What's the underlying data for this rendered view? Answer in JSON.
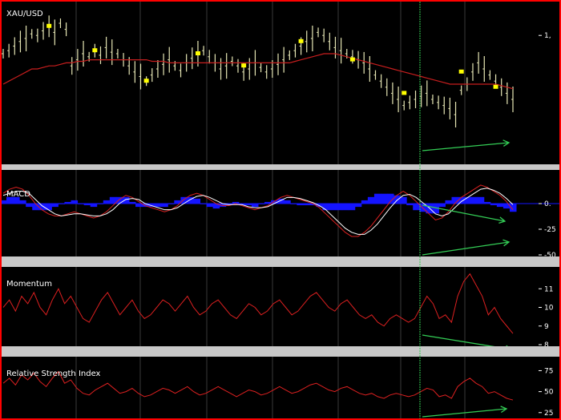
{
  "colors": {
    "background": "#000000",
    "frame": "#ff0000",
    "separator": "#c8c8c8",
    "grid": "#3a3a3a",
    "price_bar": "#e6e6b4",
    "marker": "#ffff00",
    "moving_average": "#c81e1e",
    "indicator_line": "#dc2020",
    "signal_line": "#ffffff",
    "histogram": "#1414ff",
    "annotation": "#33cc55"
  },
  "chart_data": [
    {
      "type": "bar",
      "title": "XAU/USD",
      "ylim": [
        0,
        100
      ],
      "y_ticks": [
        {
          "value": 82,
          "label": "1,"
        }
      ],
      "series": [
        {
          "values": [
            70,
            72,
            75,
            78,
            80,
            83,
            82,
            85,
            88,
            84,
            90,
            86,
            62,
            66,
            70,
            68,
            72,
            69,
            74,
            71,
            70,
            66,
            62,
            58,
            55,
            52,
            56,
            60,
            63,
            66,
            62,
            59,
            64,
            67,
            70,
            72,
            68,
            64,
            60,
            62,
            65,
            62,
            58,
            60,
            64,
            61,
            58,
            60,
            63,
            66,
            69,
            72,
            75,
            78,
            80,
            84,
            82,
            78,
            74,
            72,
            70,
            68,
            66,
            64,
            60,
            56,
            52,
            48,
            44,
            40,
            36,
            38,
            40,
            42,
            44,
            40,
            38,
            36,
            34,
            30,
            46,
            50,
            58,
            64,
            60,
            56,
            52,
            48,
            44,
            40
          ]
        },
        {
          "values": [
            50,
            52,
            54,
            56,
            58,
            60,
            60,
            61,
            62,
            62,
            63,
            64,
            64,
            65,
            65,
            66,
            66,
            66,
            66,
            66,
            66,
            66,
            66,
            66,
            66,
            66,
            65,
            65,
            65,
            64,
            64,
            64,
            64,
            64,
            64,
            64,
            64,
            64,
            64,
            64,
            64,
            64,
            64,
            64,
            64,
            64,
            64,
            64,
            64,
            64,
            64,
            65,
            66,
            67,
            68,
            69,
            70,
            70,
            70,
            69,
            68,
            67,
            66,
            65,
            64,
            63,
            62,
            61,
            60,
            59,
            58,
            57,
            56,
            55,
            54,
            53,
            52,
            51,
            50,
            50,
            50,
            50,
            50,
            50,
            50,
            50,
            50,
            49,
            48,
            47
          ]
        }
      ],
      "markers": [
        {
          "index": 8,
          "value": 88
        },
        {
          "index": 16,
          "value": 72
        },
        {
          "index": 25,
          "value": 52
        },
        {
          "index": 34,
          "value": 70
        },
        {
          "index": 42,
          "value": 62
        },
        {
          "index": 52,
          "value": 78
        },
        {
          "index": 61,
          "value": 66
        },
        {
          "index": 70,
          "value": 44
        },
        {
          "index": 80,
          "value": 58
        },
        {
          "index": 86,
          "value": 48
        }
      ]
    },
    {
      "type": "line",
      "title": "MACD",
      "ylim": [
        -50,
        25
      ],
      "y_ticks": [
        {
          "value": 0,
          "label": "0."
        },
        {
          "value": -25,
          "label": "-25"
        },
        {
          "value": -50,
          "label": "-50"
        }
      ],
      "series": [
        {
          "values": [
            10,
            14,
            16,
            14,
            8,
            0,
            -6,
            -10,
            -12,
            -12,
            -10,
            -8,
            -10,
            -12,
            -14,
            -12,
            -8,
            -2,
            4,
            8,
            6,
            2,
            -2,
            -4,
            -6,
            -8,
            -6,
            -2,
            4,
            8,
            10,
            8,
            4,
            0,
            -2,
            -2,
            0,
            -2,
            -4,
            -6,
            -4,
            -2,
            2,
            6,
            8,
            6,
            4,
            2,
            0,
            -4,
            -10,
            -16,
            -22,
            -28,
            -32,
            -32,
            -28,
            -22,
            -14,
            -6,
            2,
            8,
            12,
            8,
            2,
            -4,
            -10,
            -16,
            -14,
            -8,
            0,
            6,
            10,
            14,
            18,
            16,
            12,
            8,
            2,
            -6
          ]
        },
        {
          "values": [
            8,
            10,
            12,
            12,
            10,
            4,
            -2,
            -6,
            -10,
            -12,
            -11,
            -10,
            -10,
            -11,
            -12,
            -12,
            -10,
            -6,
            0,
            4,
            5,
            4,
            0,
            -2,
            -4,
            -6,
            -6,
            -4,
            0,
            4,
            7,
            8,
            6,
            3,
            0,
            -1,
            -1,
            -1,
            -3,
            -4,
            -4,
            -3,
            0,
            3,
            6,
            6,
            5,
            3,
            1,
            -2,
            -6,
            -12,
            -18,
            -24,
            -28,
            -30,
            -30,
            -26,
            -20,
            -12,
            -4,
            3,
            8,
            9,
            6,
            1,
            -4,
            -10,
            -12,
            -10,
            -4,
            2,
            6,
            10,
            14,
            15,
            13,
            10,
            5,
            -1
          ]
        },
        {
          "values": [
            2,
            4,
            4,
            2,
            -2,
            -4,
            -4,
            -4,
            -2,
            0,
            1,
            2,
            0,
            -1,
            -2,
            0,
            2,
            4,
            4,
            4,
            1,
            -2,
            -2,
            -2,
            -2,
            -2,
            0,
            2,
            4,
            4,
            3,
            0,
            -2,
            -3,
            -2,
            -1,
            1,
            -1,
            -1,
            -2,
            0,
            1,
            2,
            3,
            2,
            0,
            -1,
            -1,
            -1,
            -2,
            -4,
            -4,
            -4,
            -4,
            -4,
            -2,
            2,
            4,
            6,
            6,
            6,
            5,
            4,
            -1,
            -4,
            -5,
            -6,
            -6,
            -2,
            2,
            4,
            4,
            4,
            4,
            4,
            1,
            -1,
            -2,
            -3,
            -5
          ]
        }
      ]
    },
    {
      "type": "line",
      "title": "Momentum",
      "ylim": [
        80,
        120
      ],
      "y_ticks": [
        {
          "value": 110,
          "label": "11"
        },
        {
          "value": 100,
          "label": "10"
        },
        {
          "value": 90,
          "label": "9"
        },
        {
          "value": 80,
          "label": "8"
        }
      ],
      "series": [
        {
          "values": [
            100,
            104,
            98,
            106,
            102,
            108,
            100,
            96,
            104,
            110,
            102,
            106,
            100,
            94,
            92,
            98,
            104,
            108,
            102,
            96,
            100,
            104,
            98,
            94,
            96,
            100,
            104,
            102,
            98,
            102,
            106,
            100,
            96,
            98,
            102,
            104,
            100,
            96,
            94,
            98,
            102,
            100,
            96,
            98,
            102,
            104,
            100,
            96,
            98,
            102,
            106,
            108,
            104,
            100,
            98,
            102,
            104,
            100,
            96,
            94,
            96,
            92,
            90,
            94,
            96,
            94,
            92,
            94,
            100,
            106,
            102,
            94,
            96,
            92,
            106,
            114,
            118,
            112,
            106,
            96,
            100,
            94,
            90,
            86
          ]
        }
      ]
    },
    {
      "type": "line",
      "title": "Relative Strength Index",
      "ylim": [
        20,
        85
      ],
      "y_ticks": [
        {
          "value": 75,
          "label": "75"
        },
        {
          "value": 50,
          "label": "50"
        },
        {
          "value": 25,
          "label": "25"
        }
      ],
      "series": [
        {
          "values": [
            60,
            66,
            58,
            70,
            64,
            72,
            62,
            56,
            66,
            74,
            60,
            64,
            54,
            48,
            46,
            52,
            56,
            60,
            54,
            48,
            50,
            54,
            48,
            44,
            46,
            50,
            54,
            52,
            48,
            52,
            56,
            50,
            46,
            48,
            52,
            56,
            52,
            48,
            44,
            48,
            52,
            50,
            46,
            48,
            52,
            56,
            52,
            48,
            50,
            54,
            58,
            60,
            56,
            52,
            50,
            54,
            56,
            52,
            48,
            46,
            48,
            44,
            42,
            46,
            48,
            46,
            44,
            46,
            50,
            54,
            52,
            44,
            46,
            42,
            56,
            62,
            66,
            60,
            56,
            48,
            50,
            46,
            42,
            40
          ]
        }
      ]
    }
  ]
}
